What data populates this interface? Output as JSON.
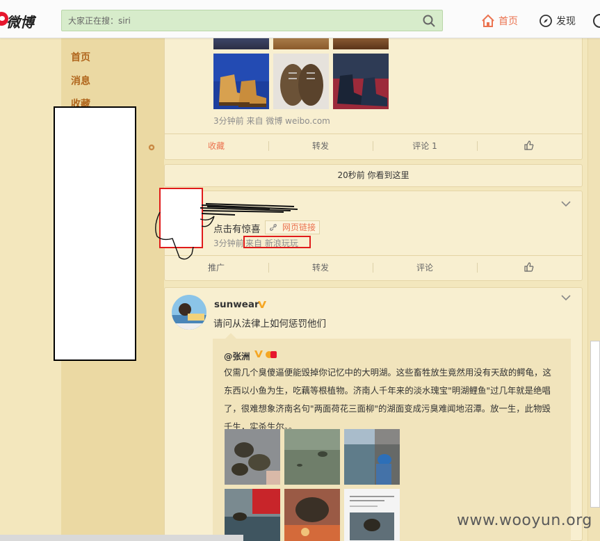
{
  "topbar": {
    "logo_text": "微博",
    "search_placeholder": "大家正在搜：siri",
    "nav_home": "首页",
    "nav_find": "发现"
  },
  "leftnav": {
    "items": [
      {
        "label": "首页"
      },
      {
        "label": "消息"
      },
      {
        "label": "收藏"
      }
    ]
  },
  "post1": {
    "meta_time": "3分钟前",
    "meta_from_label": "来自",
    "meta_source": "微博 weibo.com",
    "actions": {
      "favorite": "收藏",
      "forward": "转发",
      "comment": "评论 1"
    }
  },
  "divider": {
    "text": "20秒前 你看到这里"
  },
  "post2": {
    "text": "点击有惊喜",
    "link_label": "网页链接",
    "meta_time": "3分钟前",
    "meta_source": "来自 新浪玩玩",
    "actions": {
      "promote": "推广",
      "forward": "转发",
      "comment": "评论"
    }
  },
  "post3": {
    "username": "sunwear",
    "text": "请问从法律上如何惩罚他们",
    "repost": {
      "author": "@张洲",
      "text": "仅需几个臭傻逼便能毁掉你记忆中的大明湖。这些畜牲放生竟然用没有天敌的鳄龟，这东西以小鱼为生，吃藕等根植物。济南人千年来的淡水瑰宝\"明湖鲤鱼\"过几年就是绝唱了，很难想象济南名句\"两面荷花三面柳\"的湖面变成污臭难闻地沼潭。放一生，此物毁千生，实杀生尔。。"
    }
  },
  "watermark": "www.wooyun.org",
  "colors": {
    "accent": "#eb7350",
    "nav": "#b0661d",
    "bg": "#f3e7bd",
    "card": "#f8efd0",
    "redact_outline": "#e01b1b"
  }
}
